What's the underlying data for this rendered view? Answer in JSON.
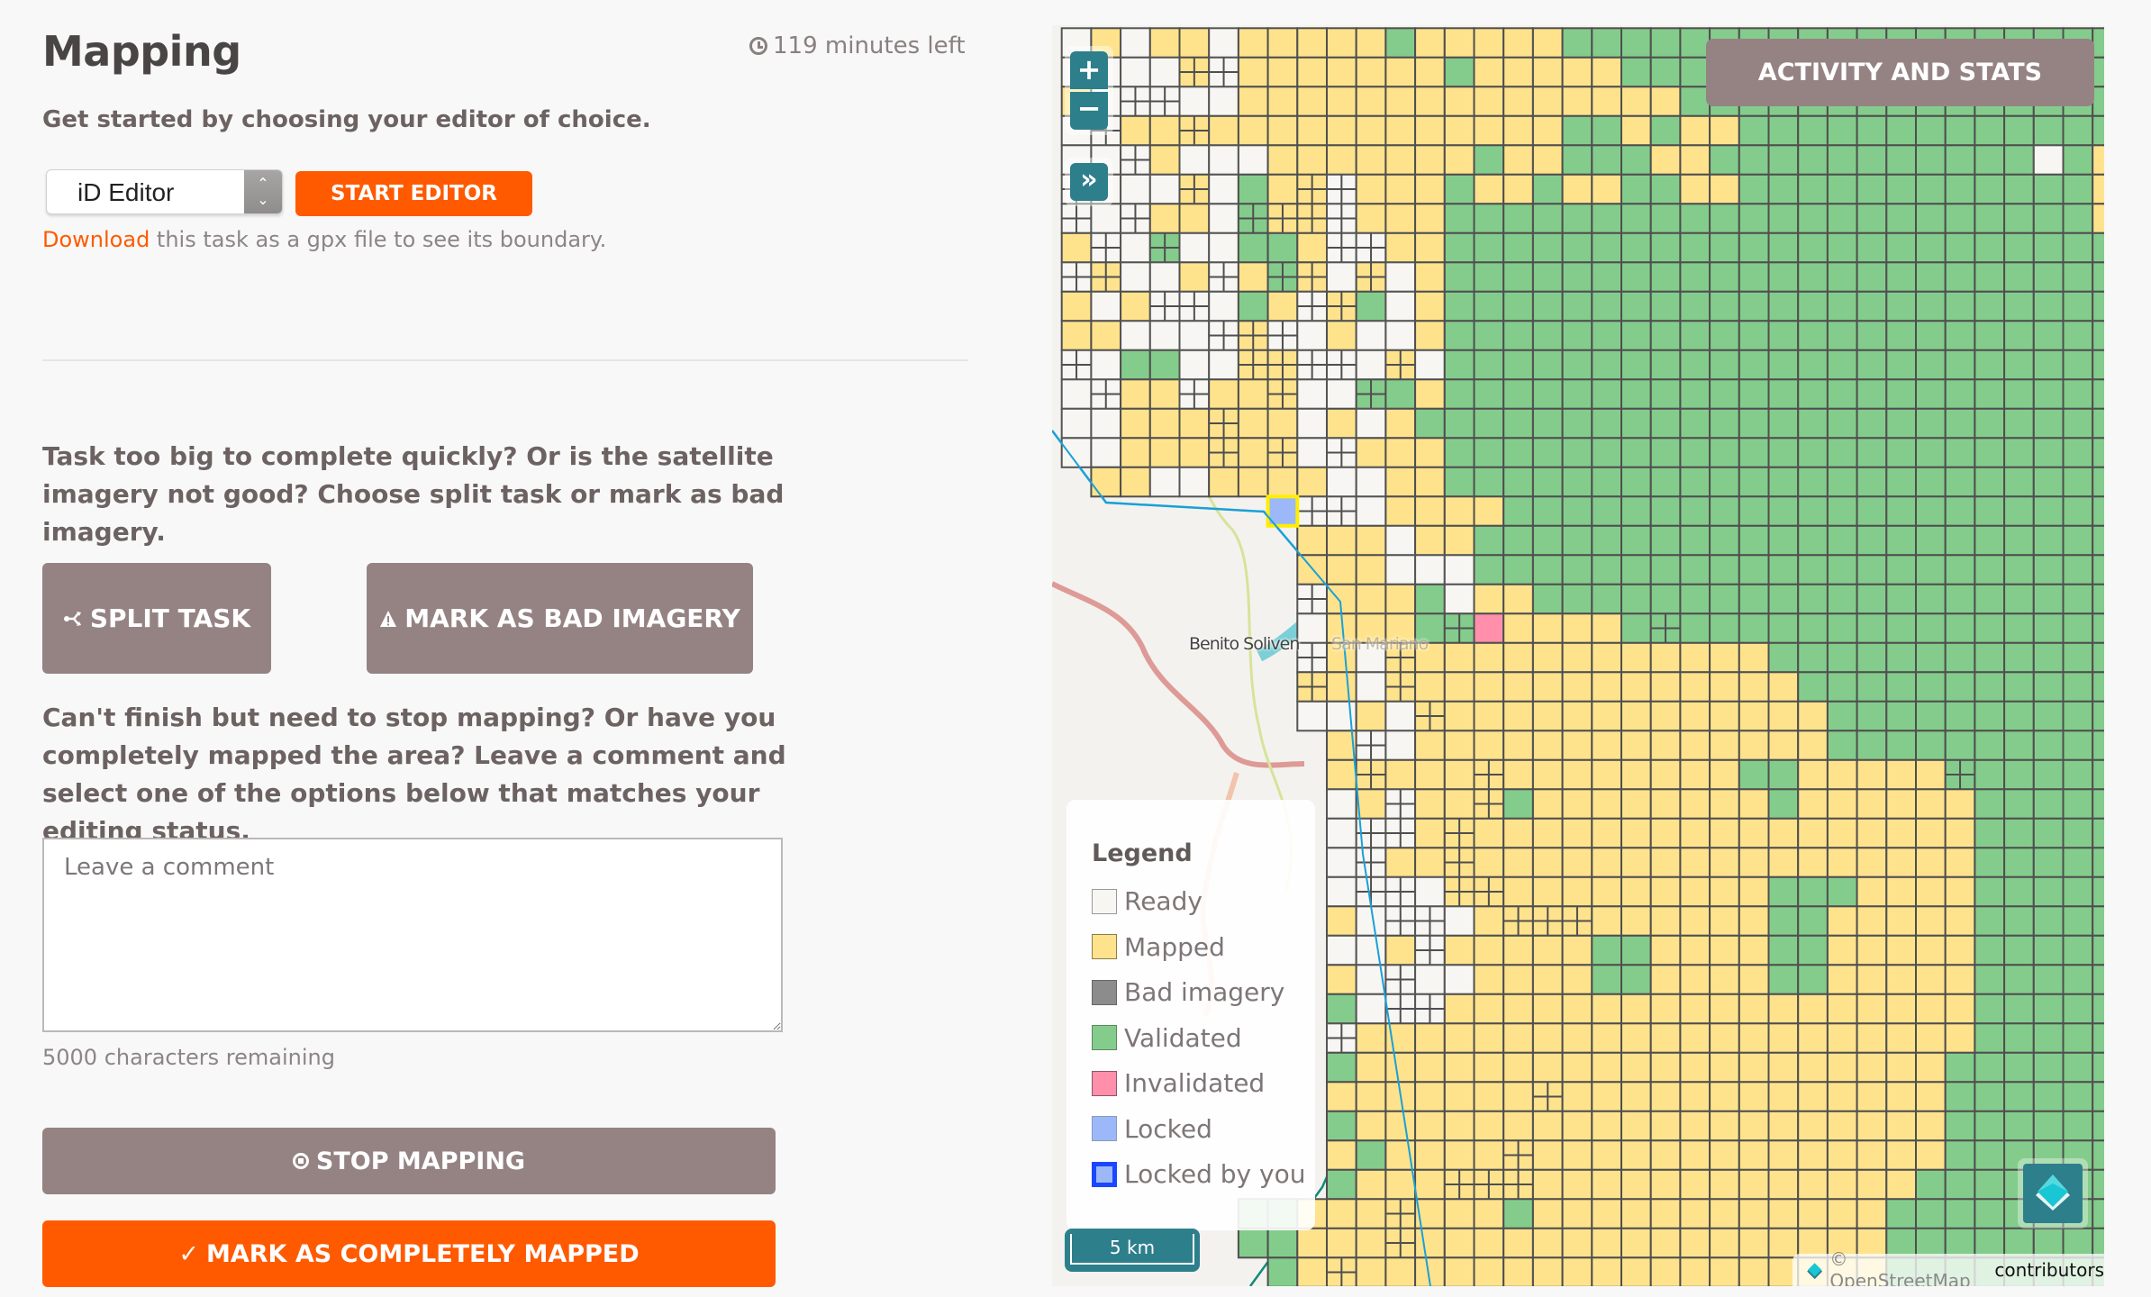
{
  "header": {
    "title": "Mapping",
    "timer_icon": "clock-icon",
    "time_left": "119 minutes left"
  },
  "editor": {
    "intro": "Get started by choosing your editor of choice.",
    "selected_editor": "iD Editor",
    "select_arrows_icon": "up-down-chevron-icon",
    "start_label": "START EDITOR",
    "download_link": "Download",
    "download_text": " this task as a gpx file to see its boundary."
  },
  "split_section": {
    "question": "Task too big to complete quickly? Or is the satellite imagery not good? Choose split task or mark as bad imagery.",
    "split_label": "SPLIT TASK",
    "split_icon": "split-icon",
    "bad_imagery_label": "MARK AS BAD IMAGERY",
    "bad_imagery_icon": "warning-icon"
  },
  "finish_section": {
    "question": "Can't finish but need to stop mapping? Or have you completely mapped the area? Leave a comment and select one of the options below that matches your editing status.",
    "comment_value": "",
    "comment_placeholder": "Leave a comment",
    "chars_remaining": "5000 characters remaining",
    "stop_label": "STOP MAPPING",
    "stop_icon": "stop-circle-icon",
    "done_label": "MARK AS COMPLETELY MAPPED",
    "done_icon": "check-icon"
  },
  "map": {
    "zoom_in": "+",
    "zoom_out": "−",
    "expand": "»",
    "activity_label": "ACTIVITY AND STATS",
    "scale_label": "5 km",
    "attribution_prefix": "© OpenStreetMap",
    "attribution_suffix": "contributors",
    "places": [
      "Benito Soliven",
      "San Mariano"
    ],
    "legend": {
      "title": "Legend",
      "items": [
        {
          "label": "Ready",
          "color": "#f7f6f3",
          "border": "#999999"
        },
        {
          "label": "Mapped",
          "color": "#ffe38c",
          "border": "#8a7d4a"
        },
        {
          "label": "Bad imagery",
          "color": "#8c8c8c",
          "border": "#666666"
        },
        {
          "label": "Validated",
          "color": "#84cc8c",
          "border": "#5a8a5e"
        },
        {
          "label": "Invalidated",
          "color": "#ff8fab",
          "border": "#8a5a66"
        },
        {
          "label": "Locked",
          "color": "#9cb8f8",
          "border": "#8a9abb"
        },
        {
          "label": "Locked by you",
          "color": "#9cb8f8",
          "border": "#1a47ff"
        }
      ]
    },
    "task_status_codes": {
      "R": "Ready",
      "M": "Mapped",
      "V": "Validated",
      "I": "Invalidated",
      "L": "Locked by you",
      ".": "none",
      "lowercase": "split into subtasks"
    },
    "task_grid": [
      ".RMRMMRMMMMMVMMMMMVVVVVVVVVVVVVVVVVVV",
      ".RRRRmrMMMMMMMVMMMMMVVVVVVVVVVVVVVVVV",
      ".MRrrRRMMMMMMMMMMMMMMMVVVVVVVVVVVVVVV",
      ".RrMMmMMMMMMMMMMMMVVMVMMVVVVVVVVVVVVV",
      ".RRrMRRRMMMMMMMVMMVVVMMVVVVVVVVVVVRVM",
      ".rRRRmRVMmrMMMVMMVMMVVMMVVVVVVVVVVVVM",
      ".rRrMMRvmmrMMMVVVVVVVVVVVVVVVVVVVVVVM",
      ".MrRvRRVVMrrMMVVVVVVVVVVVVVVVVVVVVVVV",
      ".rmRRMrMvmRmRMVVVVVVVVVVVVVVVVVVVVVVV",
      ".MRMrrRVMrmVRMVVVVVVVVVVVVVVVVVVVVVVV",
      ".MMRRRrmrRMRRMVVVVVVVVVVVVVVVVVVVVVVV",
      ".rRVVRRmmrrRmRVVVVVVVVVVVVVVVVVVVVVVV",
      ".RrMMrMMmRRvVMVVVVVVVVVVVVVVVVVVVVVVV",
      ".RRMMMmMMRMRMVVVVVVVVVVVVVVVVVVVVVVVV",
      ".RRMMMmMmRrMMMVVVVVVVVVVVVVVVVVVVVVVV",
      "..MMRRMMMMRRMMVVVVVVVVVVVVVVVVVVVVVVV",
      "........LrrRMMMMVVVVVVVVVVVVVVVVVVVVV",
      ".........MMMRMMVVVVVVVVVVVVVVVVVVVVVV",
      ".........MMMRRRVVVVVVVVVVVVVVVVVVVVVV",
      ".........rMMMVRMMVVVVVVVVVVVVVVVVVVVV",
      ".........RMMMVvIMMMMVvVVVVVVVVVVVVVVV",
      ".........rMRmMMMMMMMMMMMMVVVVVVVVVVVV",
      ".........mMRmMMMMMMMMMMMMMVVVVVVVVVVV",
      ".........RRMRmMMMMMMMMMMMMMVVVVVVVVVV",
      "..........MrRMMMMMMMMMMMMMMVVVVVVVVVV",
      "..........MmMMMmMMMMMMMMVVMMMMMvVVVVV",
      "..........RMrMMmVMMMMMMMMVMMMMMMVVVVV",
      "..........RrrMmMMMMMMMMMMMMMMMMMVVVVV",
      "..........RrMMmMMMMMMMMMMMMMMMMMVVVVV",
      "..........RrrRmmMMMMMMMMMVVVMMMMVVVVV",
      "..........MRrrRMmmmMMMMMMVVMMMMMVVVVV",
      "..........RRMrMMMMMVVMMMMVVMMMMMVVVVV",
      "..........MRrRRMMMMVVMMMMVVMMMMMVVVVV",
      "..........VRrrMMMMMMMMMMMMMMMMMMVVVVV",
      "..........rMMMMMMMMMMMMMMMMMMMMMVVVVV",
      "..........VMMMMMMMMMMMMMMMMMMMMVVVVVV",
      "..........MMMMMMMmMMMMMMMMMMMMMVVVVVV",
      "..........VMMMMMMMMMMMMMMMMMMMMVVVVVV",
      "..........MVMMMMmMMMMMMMMMMMMMMVVVVVV",
      "..........VMMMmmmMMMMMMMMMMMMMVVVVVVV",
      ".......VVMMMmMMMVMMMMMMMMMMMMVVVVVVVV",
      ".......VVMMMmMMMMMMMMMMMMMMMMVVVVVVVV",
      "........VMmMMMMMMMMMMMMMMMMMMVVVVVVVV"
    ]
  }
}
